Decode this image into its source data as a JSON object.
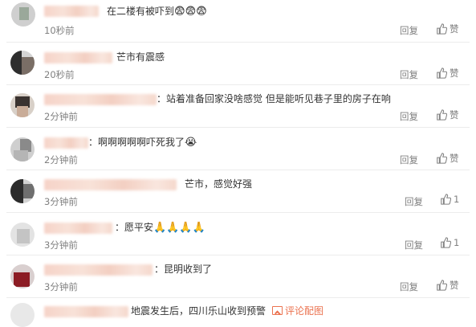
{
  "comments": [
    {
      "text": "在二楼有被吓到",
      "emoji": "😨😨😨",
      "time": "10秒前",
      "reply": "回复",
      "like": "赞"
    },
    {
      "text": "芒市有震感",
      "emoji": "",
      "time": "20秒前",
      "reply": "回复",
      "like": "赞"
    },
    {
      "text": "：站着准备回家没啥感觉 但是能听见巷子里的房子在响",
      "emoji": "",
      "time": "2分钟前",
      "reply": "回复",
      "like": "赞"
    },
    {
      "text": "：啊啊啊啊啊吓死我了",
      "emoji": "😭",
      "time": "2分钟前",
      "reply": "回复",
      "like": "赞"
    },
    {
      "text": "芒市，感觉好强",
      "emoji": "",
      "time": "3分钟前",
      "reply": "回复",
      "like": "1"
    },
    {
      "text": "：愿平安",
      "emoji": "🙏🙏🙏🙏",
      "time": "3分钟前",
      "reply": "回复",
      "like": "1"
    },
    {
      "text": "：昆明收到了",
      "emoji": "",
      "time": "3分钟前",
      "reply": "回复",
      "like": "赞"
    },
    {
      "text": "地震发生后，四川乐山收到预警",
      "emoji": "",
      "link": "评论配图",
      "time": "",
      "reply": "",
      "like": ""
    }
  ],
  "colors": {
    "text": "#333333",
    "meta": "#808080",
    "link": "#eb7350",
    "divider": "#ececec"
  },
  "icons": {
    "like": "thumbs-up-icon",
    "picture": "image-icon"
  }
}
